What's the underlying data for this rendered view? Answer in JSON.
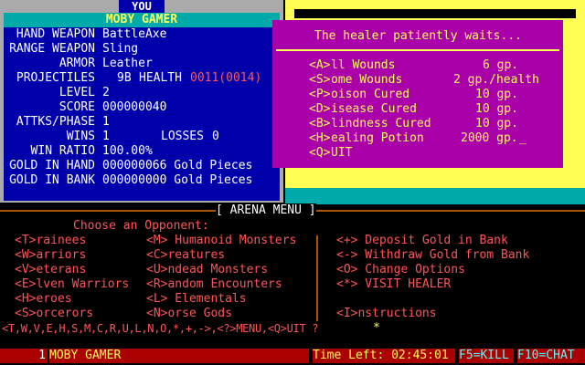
{
  "you_panel": {
    "tab": "YOU",
    "name": "MOBY GAMER",
    "rows": {
      "hand_weapon": {
        "label": "HAND WEAPON",
        "value": "BattleAxe"
      },
      "range_weapon": {
        "label": "RANGE WEAPON",
        "value": "Sling"
      },
      "armor": {
        "label": "ARMOR",
        "value": "Leather"
      },
      "projectiles": {
        "label": "PROJECTILES",
        "value": "9B",
        "health_label": "HEALTH",
        "health_value": "0011(0014)"
      },
      "level": {
        "label": "LEVEL",
        "value": "2"
      },
      "score": {
        "label": "SCORE",
        "value": "000000040"
      },
      "attks": {
        "label": "ATTKS/PHASE",
        "value": "1"
      },
      "wins": {
        "label": "WINS",
        "value": "1",
        "losses_label": "LOSSES",
        "losses_value": "0"
      },
      "win_ratio": {
        "label": "WIN RATIO",
        "value": "100.00%"
      },
      "gold_hand": {
        "label": "GOLD IN HAND",
        "value": "000000066 Gold Pieces"
      },
      "gold_bank": {
        "label": "GOLD IN BANK",
        "value": "000000000 Gold Pieces"
      }
    }
  },
  "healer": {
    "title": "The healer patiently waits...",
    "options": [
      {
        "key": "<A>",
        "text": "ll Wounds",
        "price": "6 gp."
      },
      {
        "key": "<S>",
        "text": "ome Wounds",
        "price": "2 gp./health"
      },
      {
        "key": "<P>",
        "text": "oison Cured",
        "price": "10 gp."
      },
      {
        "key": "<D>",
        "text": "isease Cured",
        "price": "10 gp."
      },
      {
        "key": "<B>",
        "text": "lindness Cured",
        "price": "10 gp."
      },
      {
        "key": "<H>",
        "text": "ealing Potion",
        "price": "2000 gp."
      },
      {
        "key": "<Q>",
        "text": "UIT",
        "price": ""
      }
    ]
  },
  "arena": {
    "title": "[ ARENA MENU ]",
    "header": "Choose an Opponent:",
    "col1": [
      "<T>rainees",
      "<W>arriors",
      "<V>eterans",
      "<E>lven Warriors",
      "<H>eroes",
      "<S>orcerors"
    ],
    "col2": [
      "<M> Humanoid Monsters",
      "<C>reatures",
      "<U>ndead Monsters",
      "<R>andom Encounters",
      "<L> Elementals",
      "<N>orse Gods"
    ],
    "col3": [
      "<+> Deposit Gold in Bank",
      "<-> Withdraw Gold from Bank",
      "<O> Change Options",
      "<*> VISIT HEALER",
      "",
      "<I>nstructions"
    ],
    "prompt": "<T,W,V,E,H,S,M,C,R,U,L,N,O,*,+,->,<?>MENU,<Q>UIT ? ",
    "prompt_cursor": "*"
  },
  "status_bar": {
    "node": "1",
    "user": "MOBY GAMER",
    "time_label": "Time Left:",
    "time_value": "02:45:01",
    "f5": "F5=KILL",
    "f10": "F10=CHAT"
  }
}
